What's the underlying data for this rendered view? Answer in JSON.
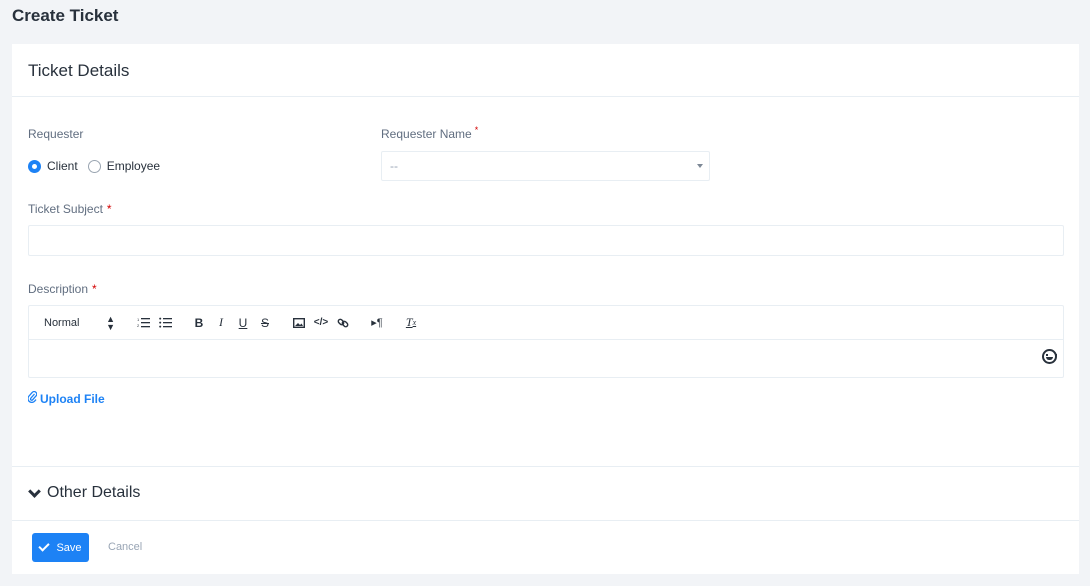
{
  "page": {
    "title": "Create Ticket"
  },
  "card": {
    "title": "Ticket Details"
  },
  "requester": {
    "label": "Requester",
    "options": [
      {
        "label": "Client",
        "checked": true
      },
      {
        "label": "Employee",
        "checked": false
      }
    ]
  },
  "requester_name": {
    "label": "Requester Name",
    "required": "*",
    "value": "--"
  },
  "ticket_subject": {
    "label": "Ticket Subject",
    "required": "*",
    "value": ""
  },
  "description": {
    "label": "Description",
    "required": "*",
    "toolbar": {
      "format": "Normal",
      "buttons": [
        "ordered-list",
        "bullet-list",
        "bold",
        "italic",
        "underline",
        "strike",
        "image",
        "code",
        "link",
        "rtl",
        "clear-format"
      ]
    }
  },
  "upload": {
    "label": "Upload File"
  },
  "other_details": {
    "label": "Other Details"
  },
  "footer": {
    "save_label": "Save",
    "cancel_label": "Cancel"
  },
  "colors": {
    "accent": "#1d82f5",
    "text": "#28313c",
    "muted": "#616e80",
    "required": "#d30000"
  }
}
